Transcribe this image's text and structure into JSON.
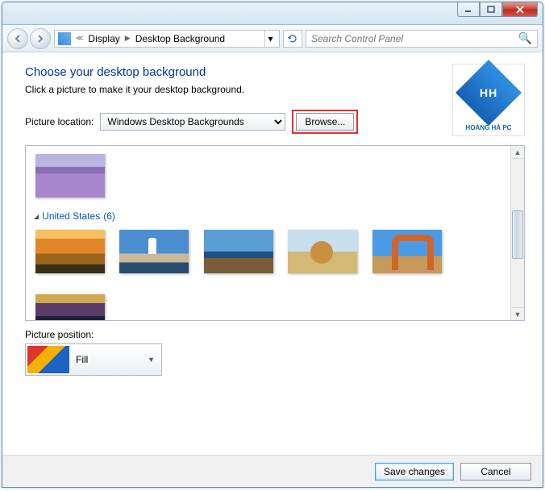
{
  "breadcrumb": {
    "item1": "Display",
    "item2": "Desktop Background"
  },
  "search": {
    "placeholder": "Search Control Panel"
  },
  "heading": "Choose your desktop background",
  "subhead": "Click a picture to make it your desktop background.",
  "picloc": {
    "label": "Picture location:",
    "value": "Windows Desktop Backgrounds",
    "browse": "Browse..."
  },
  "group": {
    "name": "United States",
    "count": "(6)"
  },
  "picpos": {
    "label": "Picture position:",
    "value": "Fill"
  },
  "footer": {
    "save": "Save changes",
    "cancel": "Cancel"
  },
  "logo": {
    "text": "HOÀNG HÀ PC",
    "mark": "HH"
  }
}
